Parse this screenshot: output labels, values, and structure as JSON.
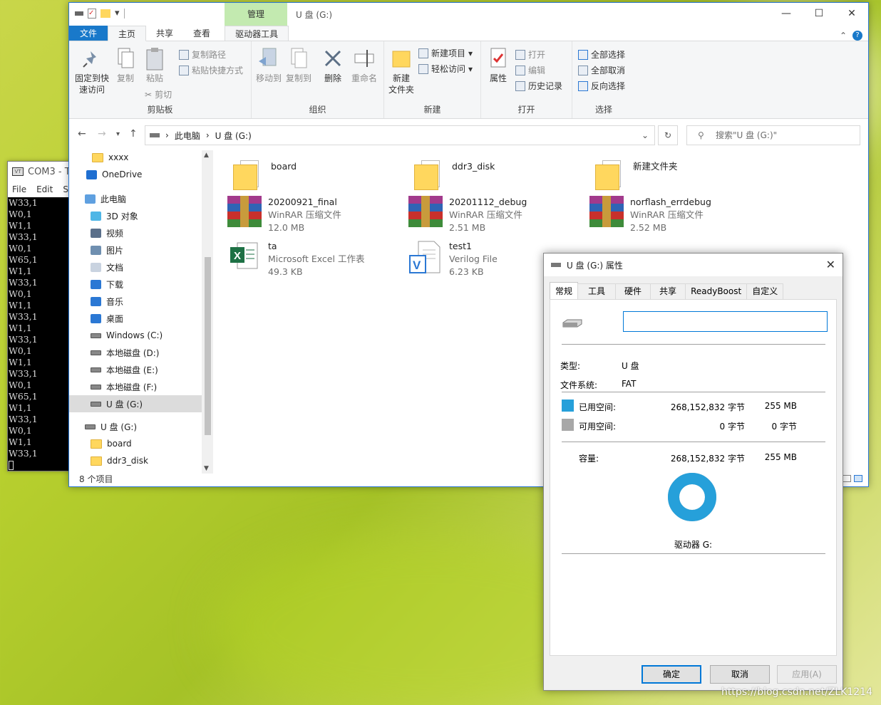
{
  "terminal": {
    "title": "COM3 - T",
    "menu": [
      "File",
      "Edit",
      "Se"
    ],
    "lines": [
      "W33,1",
      "W0,1",
      "W1,1",
      "W33,1",
      "W0,1",
      "W65,1",
      "W1,1",
      "W33,1",
      "W0,1",
      "W1,1",
      "W33,1",
      "W1,1",
      "W33,1",
      "W0,1",
      "W1,1",
      "W33,1",
      "W0,1",
      "W65,1",
      "W1,1",
      "W33,1",
      "W0,1",
      "W1,1",
      "W33,1"
    ]
  },
  "explorer": {
    "context_tab": "管理",
    "window_title": "U 盘 (G:)",
    "tabs": {
      "file": "文件",
      "home": "主页",
      "share": "共享",
      "view": "查看",
      "drive_tools": "驱动器工具"
    },
    "ribbon": {
      "clipboard": {
        "name": "剪贴板",
        "pin": "固定到快\n速访问",
        "copy": "复制",
        "paste": "粘贴",
        "copy_path": "复制路径",
        "paste_shortcut": "粘贴快捷方式",
        "cut": "剪切"
      },
      "organize": {
        "name": "组织",
        "move_to": "移动到",
        "copy_to": "复制到",
        "delete": "删除",
        "rename": "重命名"
      },
      "new": {
        "name": "新建",
        "new_folder": "新建\n文件夹",
        "new_item": "新建项目",
        "easy_access": "轻松访问"
      },
      "open": {
        "name": "打开",
        "properties": "属性",
        "open": "打开",
        "edit": "编辑",
        "history": "历史记录"
      },
      "select": {
        "name": "选择",
        "select_all": "全部选择",
        "select_none": "全部取消",
        "invert": "反向选择"
      }
    },
    "address": {
      "this_pc": "此电脑",
      "drive": "U 盘 (G:)",
      "search_placeholder": "搜索\"U 盘 (G:)\""
    },
    "nav": [
      {
        "label": "xxxx",
        "icon": "folder-icon"
      },
      {
        "label": "OneDrive",
        "icon": "cloud-icon"
      },
      {
        "label": "此电脑",
        "icon": "computer-icon"
      },
      {
        "label": "3D 对象",
        "icon": "cube-icon"
      },
      {
        "label": "视频",
        "icon": "video-icon"
      },
      {
        "label": "图片",
        "icon": "picture-icon"
      },
      {
        "label": "文档",
        "icon": "document-icon"
      },
      {
        "label": "下载",
        "icon": "download-icon"
      },
      {
        "label": "音乐",
        "icon": "music-icon"
      },
      {
        "label": "桌面",
        "icon": "desktop-icon"
      },
      {
        "label": "Windows (C:)",
        "icon": "windows-drive-icon"
      },
      {
        "label": "本地磁盘 (D:)",
        "icon": "drive-icon"
      },
      {
        "label": "本地磁盘 (E:)",
        "icon": "drive-icon"
      },
      {
        "label": "本地磁盘 (F:)",
        "icon": "drive-icon"
      },
      {
        "label": "U 盘 (G:)",
        "icon": "usb-drive-icon"
      },
      {
        "label": "U 盘 (G:)",
        "icon": "usb-drive-icon"
      },
      {
        "label": "board",
        "icon": "folder-icon"
      },
      {
        "label": "ddr3_disk",
        "icon": "folder-icon"
      }
    ],
    "status": "8 个项目",
    "files": [
      {
        "name": "board",
        "type": "",
        "size": "",
        "icon": "folder-icon"
      },
      {
        "name": "ddr3_disk",
        "type": "",
        "size": "",
        "icon": "folder-icon"
      },
      {
        "name": "新建文件夹",
        "type": "",
        "size": "",
        "icon": "folder-icon"
      },
      {
        "name": "20200921_final",
        "type": "WinRAR 压缩文件",
        "size": "12.0 MB",
        "icon": "winrar-icon"
      },
      {
        "name": "20201112_debug",
        "type": "WinRAR 压缩文件",
        "size": "2.51 MB",
        "icon": "winrar-icon"
      },
      {
        "name": "norflash_errdebug",
        "type": "WinRAR 压缩文件",
        "size": "2.52 MB",
        "icon": "winrar-icon"
      },
      {
        "name": "ta",
        "type": "Microsoft Excel 工作表",
        "size": "49.3 KB",
        "icon": "excel-icon"
      },
      {
        "name": "test1",
        "type": "Verilog File",
        "size": "6.23 KB",
        "icon": "verilog-icon"
      }
    ]
  },
  "properties": {
    "title": "U 盘 (G:) 属性",
    "tabs": [
      "常规",
      "工具",
      "硬件",
      "共享",
      "ReadyBoost",
      "自定义"
    ],
    "label_value": "",
    "type_label": "类型:",
    "type_value": "U 盘",
    "fs_label": "文件系统:",
    "fs_value": "FAT",
    "used_label": "已用空间:",
    "used_bytes": "268,152,832 字节",
    "used_mb": "255 MB",
    "free_label": "可用空间:",
    "free_bytes": "0 字节",
    "free_mb": "0 字节",
    "capacity_label": "容量:",
    "capacity_bytes": "268,152,832 字节",
    "capacity_mb": "255 MB",
    "drive_label": "驱动器 G:",
    "used_fraction": 1.0,
    "colors": {
      "used": "#26a0da",
      "free": "#a8a8a8"
    },
    "buttons": {
      "ok": "确定",
      "cancel": "取消",
      "apply": "应用(A)"
    }
  },
  "watermark": "https://blog.csdn.net/ZLK1214"
}
